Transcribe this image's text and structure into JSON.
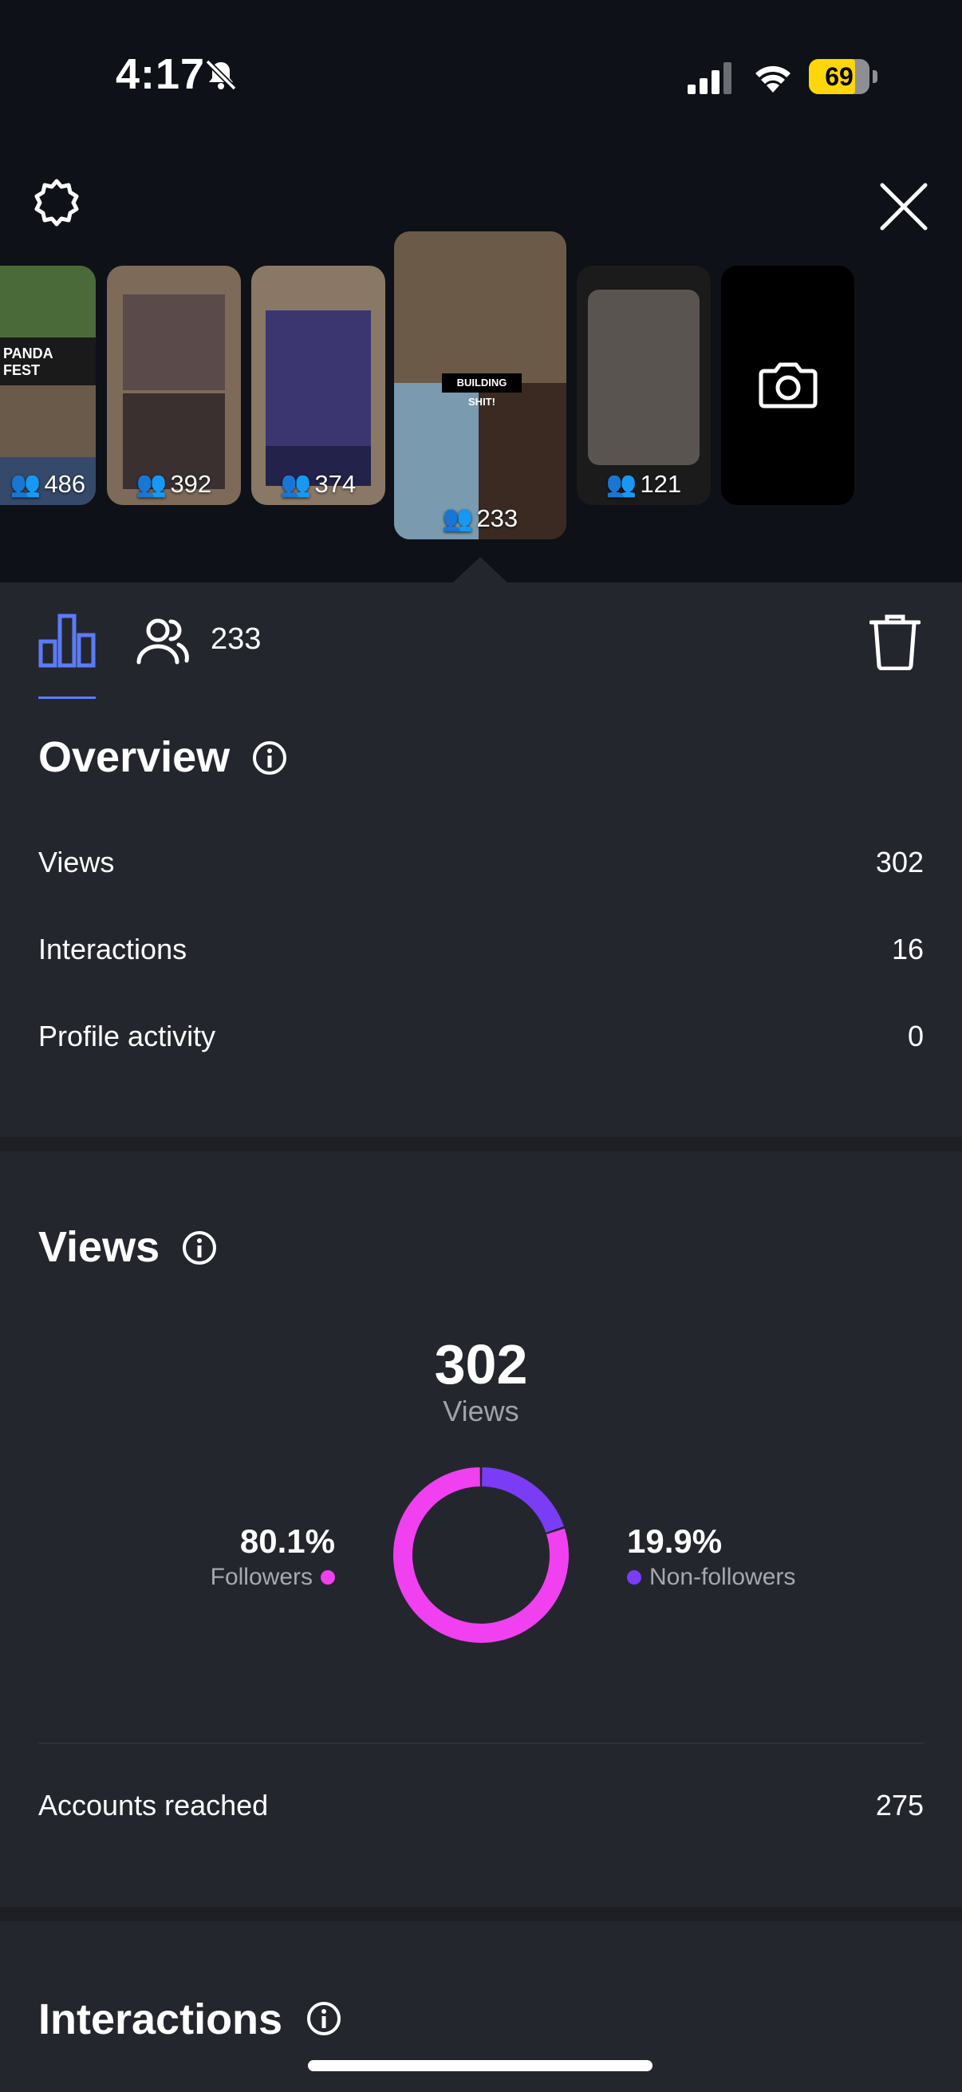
{
  "status_bar": {
    "time": "4:17",
    "battery": "69"
  },
  "stories": [
    {
      "viewers": "486",
      "caption": "PANDA FEST"
    },
    {
      "viewers": "392"
    },
    {
      "viewers": "374"
    },
    {
      "viewers": "233",
      "caption": "BUILDING SHIT!"
    },
    {
      "viewers": "121"
    }
  ],
  "tabs": {
    "viewers_count": "233"
  },
  "overview": {
    "title": "Overview",
    "rows": [
      {
        "label": "Views",
        "value": "302"
      },
      {
        "label": "Interactions",
        "value": "16"
      },
      {
        "label": "Profile activity",
        "value": "0"
      }
    ]
  },
  "views": {
    "title": "Views",
    "total": "302",
    "total_label": "Views",
    "followers_pct": "80.1%",
    "followers_label": "Followers",
    "nonfollowers_pct": "19.9%",
    "nonfollowers_label": "Non-followers",
    "accounts_reached_label": "Accounts reached",
    "accounts_reached_value": "275"
  },
  "interactions": {
    "title": "Interactions"
  },
  "colors": {
    "followers": "#f040f0",
    "nonfollowers": "#7a3cf5",
    "accent": "#5b7cf6"
  },
  "chart_data": {
    "type": "pie",
    "categories": [
      "Followers",
      "Non-followers"
    ],
    "values": [
      80.1,
      19.9
    ]
  },
  "icons": [
    "bell-slash-icon",
    "signal-icon",
    "wifi-icon",
    "battery-icon",
    "gear-icon",
    "close-icon",
    "camera-icon",
    "bar-chart-icon",
    "people-icon",
    "trash-icon",
    "info-icon"
  ]
}
